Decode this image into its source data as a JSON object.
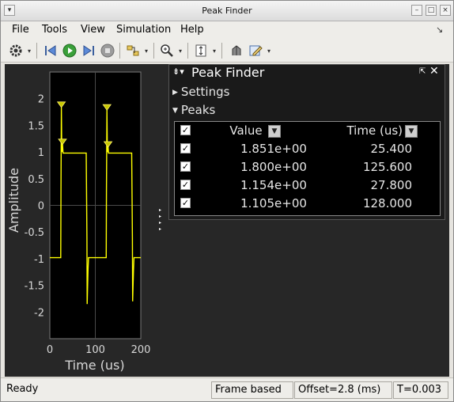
{
  "window": {
    "title": "Peak Finder"
  },
  "menu": [
    {
      "label": "File",
      "accel": "F"
    },
    {
      "label": "Tools",
      "accel": "T"
    },
    {
      "label": "View",
      "accel": "V"
    },
    {
      "label": "Simulation",
      "accel": "S"
    },
    {
      "label": "Help",
      "accel": "H"
    }
  ],
  "toolbar": {
    "icons": [
      "gear-icon",
      "step-back-icon",
      "run-icon",
      "step-forward-icon",
      "stop-icon",
      "signal-select-icon",
      "zoom-in-icon",
      "autoscale-icon",
      "highlight-icon",
      "style-icon"
    ]
  },
  "peak_finder": {
    "title": "Peak Finder",
    "settings_label": "Settings",
    "peaks_label": "Peaks",
    "columns": {
      "value": "Value",
      "time": "Time (us)"
    },
    "rows": [
      {
        "value": "1.851e+00",
        "time": "25.400",
        "checked": true
      },
      {
        "value": "1.800e+00",
        "time": "125.600",
        "checked": true
      },
      {
        "value": "1.154e+00",
        "time": "27.800",
        "checked": true
      },
      {
        "value": "1.105e+00",
        "time": "128.000",
        "checked": true
      }
    ]
  },
  "chart_data": {
    "type": "line",
    "xlabel": "Time (us)",
    "ylabel": "Amplitude",
    "xlim": [
      0,
      200
    ],
    "ylim": [
      -2.5,
      2.5
    ],
    "xticks": [
      "0",
      "100",
      "200"
    ],
    "yticks": [
      "2",
      "1.5",
      "1",
      "0.5",
      "0",
      "-0.5",
      "-1",
      "-1.5",
      "-2"
    ],
    "grid": true,
    "line_color": "#ffff00",
    "series": [
      {
        "x": [
          0,
          24,
          24.5,
          25.4,
          26.2,
          27.8,
          29,
          80,
          81.5,
          82,
          84,
          85,
          99,
          100,
          124,
          124.5,
          125.6,
          126.4,
          128,
          129,
          180,
          181.5,
          182,
          184,
          185,
          200
        ],
        "y": [
          -0.98,
          -0.98,
          0.3,
          1.851,
          1.0,
          1.154,
          0.98,
          0.98,
          -0.6,
          -1.85,
          -1.2,
          -0.98,
          -0.98,
          -0.98,
          -0.98,
          0.3,
          1.8,
          1.0,
          1.105,
          0.98,
          0.98,
          -0.6,
          -1.8,
          -1.2,
          -0.98,
          -0.98
        ]
      }
    ],
    "peaks": [
      {
        "x": 25.4,
        "y": 1.851
      },
      {
        "x": 125.6,
        "y": 1.8
      },
      {
        "x": 27.8,
        "y": 1.154
      },
      {
        "x": 128,
        "y": 1.105
      }
    ]
  },
  "status": {
    "state": "Ready",
    "mode": "Frame based",
    "offset": "Offset=2.8 (ms)",
    "time": "T=0.003"
  }
}
